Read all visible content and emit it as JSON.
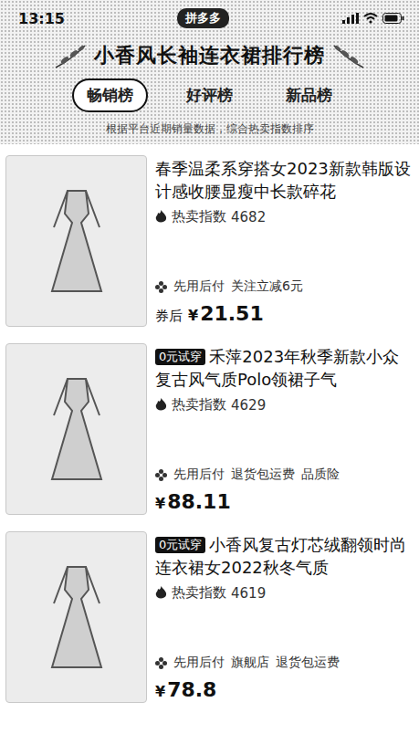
{
  "status_bar": {
    "time": "13:15",
    "app": "拼多多"
  },
  "title": "小香风长袖连衣裙排行榜",
  "tabs": [
    {
      "label": "畅销榜",
      "selected": true
    },
    {
      "label": "好评榜",
      "selected": false
    },
    {
      "label": "新品榜",
      "selected": false
    }
  ],
  "subtitle": "根据平台近期销量数据，综合热卖指数排序",
  "products": [
    {
      "badge": "",
      "title": "春季温柔系穿搭女2023新款韩版设计感收腰显瘦中长款碎花",
      "heat_label": "热卖指数",
      "heat": "4682",
      "tags": [
        "先用后付",
        "关注立减6元"
      ],
      "price_prefix": "券后",
      "currency": "¥",
      "price": "21.51"
    },
    {
      "badge": "0元试穿",
      "title": "禾萍2023年秋季新款小众复古风气质Polo领裙子气",
      "heat_label": "热卖指数",
      "heat": "4629",
      "tags": [
        "先用后付",
        "退货包运费",
        "品质险"
      ],
      "price_prefix": "",
      "currency": "¥",
      "price": "88.11"
    },
    {
      "badge": "0元试穿",
      "title": "小香风复古灯芯绒翻领时尚连衣裙女2022秋冬气质",
      "heat_label": "热卖指数",
      "heat": "4619",
      "tags": [
        "先用后付",
        "旗舰店",
        "退货包运费"
      ],
      "price_prefix": "",
      "currency": "¥",
      "price": "78.8"
    }
  ]
}
